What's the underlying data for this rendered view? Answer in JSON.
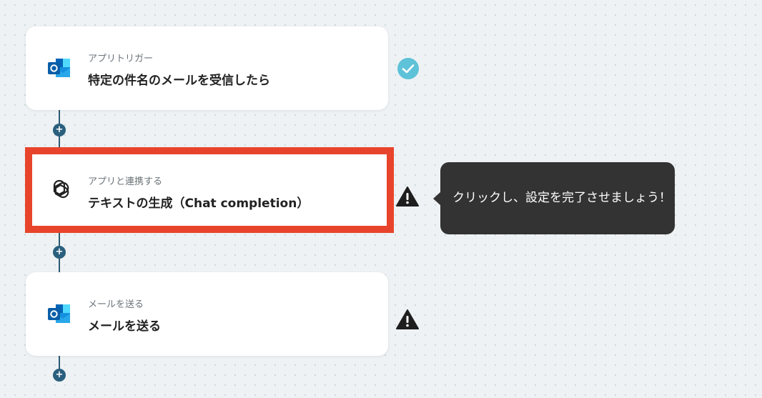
{
  "flow": {
    "steps": [
      {
        "subtitle": "アプリトリガー",
        "title": "特定の件名のメールを受信したら",
        "app_icon": "outlook-icon",
        "status": "complete",
        "status_icon": "check-circle-icon"
      },
      {
        "subtitle": "アプリと連携する",
        "title": "テキストの生成（Chat completion）",
        "app_icon": "openai-icon",
        "status": "warning",
        "status_icon": "warning-icon"
      },
      {
        "subtitle": "メールを送る",
        "title": "メールを送る",
        "app_icon": "outlook-icon",
        "status": "warning",
        "status_icon": "warning-icon"
      }
    ],
    "add_step_symbol": "+"
  },
  "tooltip": {
    "text": "クリックし、設定を完了させましょう！"
  },
  "colors": {
    "highlight_border": "#e8442b",
    "check_circle": "#5ec2d8",
    "connector": "#2e5a72",
    "tooltip_bg": "#333333"
  }
}
